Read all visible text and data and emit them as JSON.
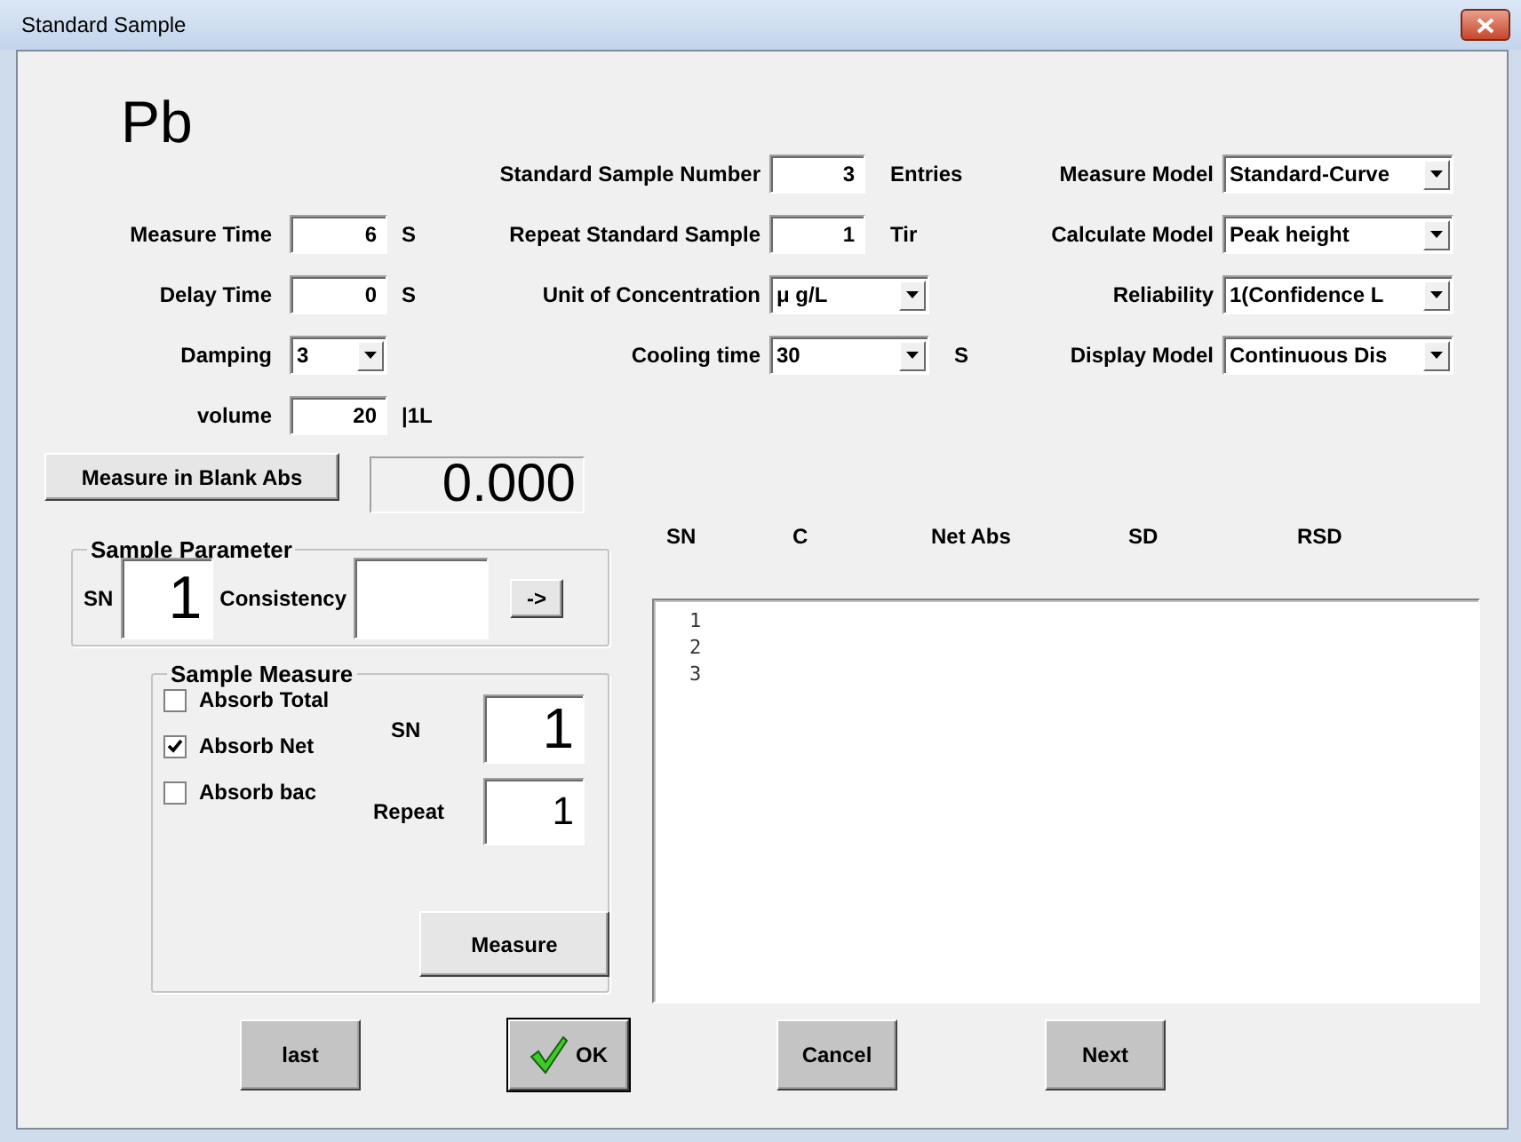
{
  "window": {
    "title": "Standard Sample"
  },
  "element": "Pb",
  "rows": [
    {
      "middle": {
        "label": "Standard Sample Number",
        "kind": "input",
        "value": "3",
        "unit": "Entries"
      },
      "right": {
        "label": "Measure Model",
        "kind": "select",
        "value": "Standard-Curve"
      }
    },
    {
      "left": {
        "label": "Measure Time",
        "kind": "input",
        "value": "6",
        "unit": "S"
      },
      "middle": {
        "label": "Repeat Standard Sample",
        "kind": "input",
        "value": "1",
        "unit": "Tir"
      },
      "right": {
        "label": "Calculate Model",
        "kind": "select",
        "value": "Peak height"
      }
    },
    {
      "left": {
        "label": "Delay Time",
        "kind": "input",
        "value": "0",
        "unit": "S"
      },
      "middle": {
        "label": "Unit of Concentration",
        "kind": "select",
        "value": "μ g/L"
      },
      "right": {
        "label": "Reliability",
        "kind": "select",
        "value": "1(Confidence L"
      }
    },
    {
      "left": {
        "label": "Damping",
        "kind": "select",
        "value": "3"
      },
      "middle": {
        "label": "Cooling time",
        "kind": "select",
        "value": "30",
        "unit": "S"
      },
      "right": {
        "label": "Display Model",
        "kind": "select",
        "value": "Continuous Dis"
      }
    },
    {
      "left": {
        "label": "volume",
        "kind": "input",
        "value": "20",
        "unit": "|1L"
      }
    }
  ],
  "blank": {
    "button": "Measure in Blank Abs",
    "reading": "0.000"
  },
  "sample_parameter": {
    "title": "Sample Parameter",
    "sn_label": "SN",
    "sn_value": "1",
    "consistency_label": "Consistency",
    "apply_button": "->"
  },
  "table": {
    "columns": [
      "SN",
      "C",
      "Net Abs",
      "SD",
      "RSD"
    ],
    "rows": [
      "1",
      "2",
      "3"
    ]
  },
  "sample_measure": {
    "title": "Sample Measure",
    "options": [
      {
        "label": "Absorb Total",
        "checked": false
      },
      {
        "label": "Absorb Net",
        "checked": true
      },
      {
        "label": "Absorb bac",
        "checked": false
      }
    ],
    "sn_label": "SN",
    "sn_value": "1",
    "repeat_label": "Repeat",
    "repeat_value": "1",
    "measure_button": "Measure"
  },
  "buttons": [
    {
      "label": "last",
      "kind": "plain"
    },
    {
      "label": "OK",
      "kind": "default"
    },
    {
      "label": "Cancel",
      "kind": "plain"
    },
    {
      "label": "Next",
      "kind": "plain"
    }
  ]
}
